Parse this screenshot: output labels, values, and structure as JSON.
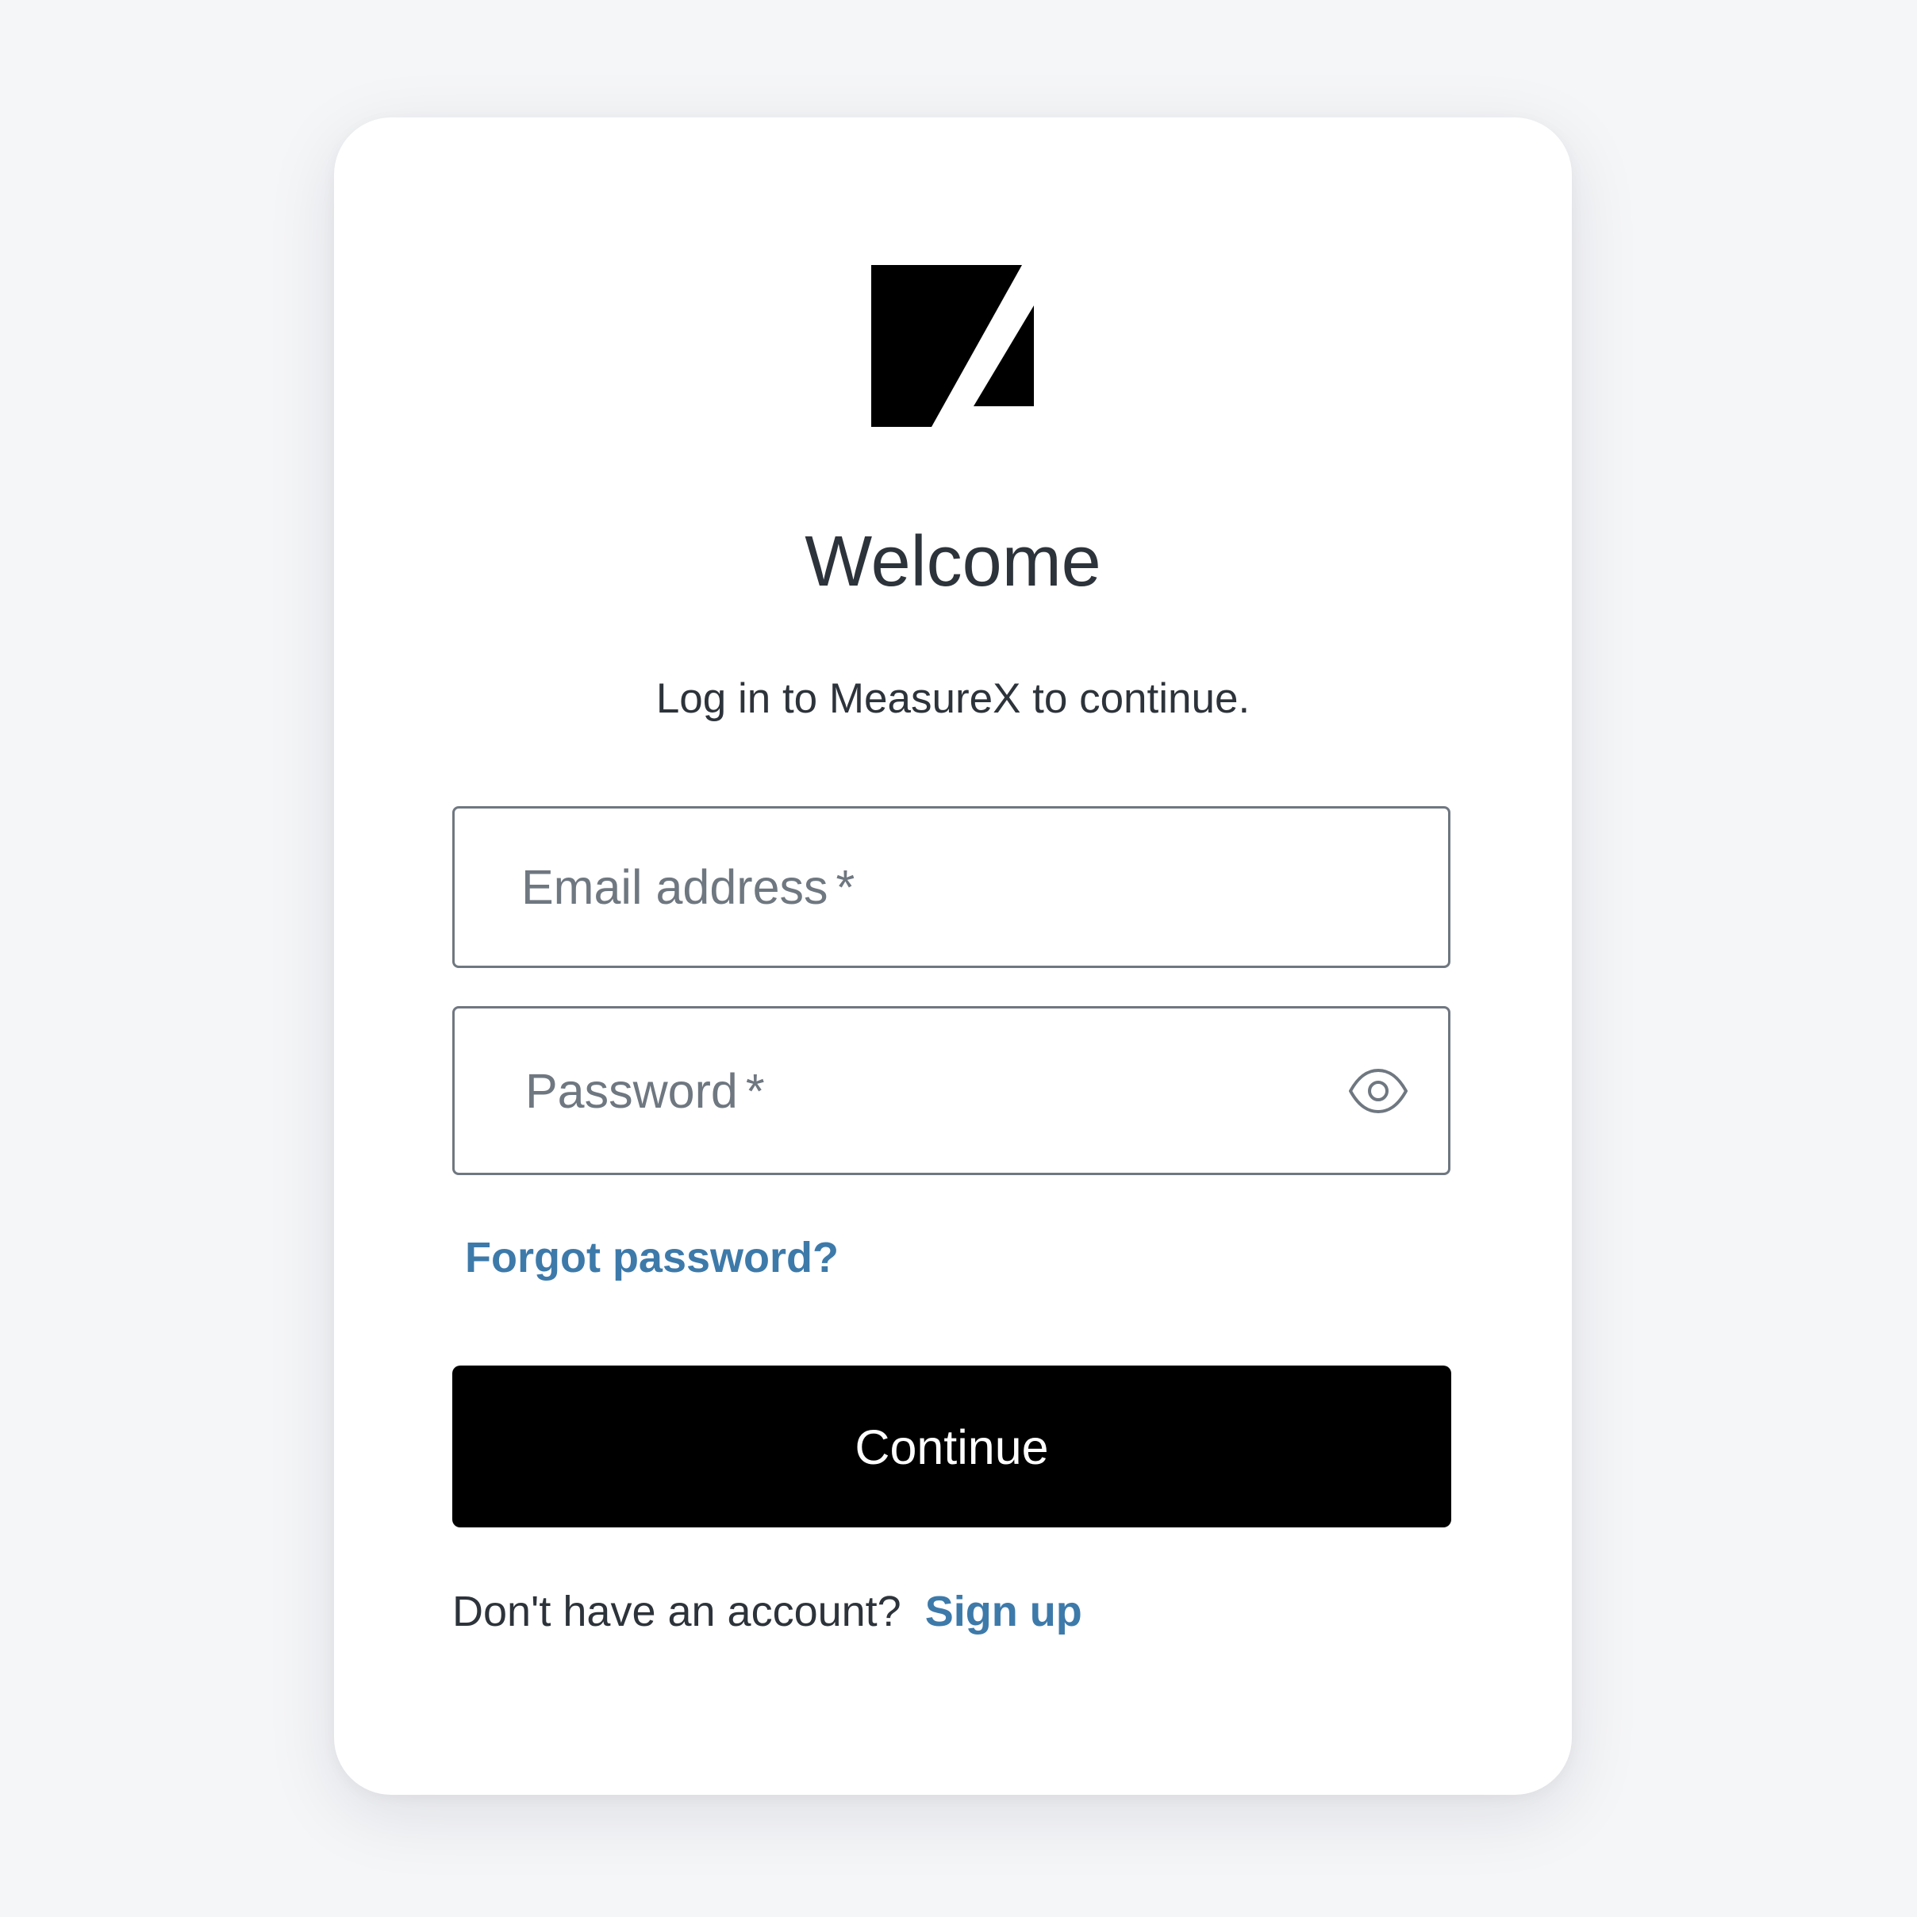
{
  "brand": {
    "logo_icon": "measurex-logo-icon",
    "logo_color": "#000000"
  },
  "header": {
    "title": "Welcome",
    "subtitle": "Log in to MeasureX to continue."
  },
  "form": {
    "email": {
      "placeholder": "Email address",
      "required_marker": "*",
      "value": ""
    },
    "password": {
      "placeholder": "Password",
      "required_marker": "*",
      "value": "",
      "toggle_icon": "eye-icon"
    },
    "forgot_password_label": "Forgot password?",
    "continue_label": "Continue"
  },
  "footer": {
    "prompt": "Don't have an account?",
    "signup_label": "Sign up"
  },
  "colors": {
    "background": "#f5f6f8",
    "card": "#ffffff",
    "text": "#2d333a",
    "placeholder": "#6f7780",
    "link": "#3d7aaa",
    "button": "#000000",
    "button_text": "#ffffff"
  }
}
